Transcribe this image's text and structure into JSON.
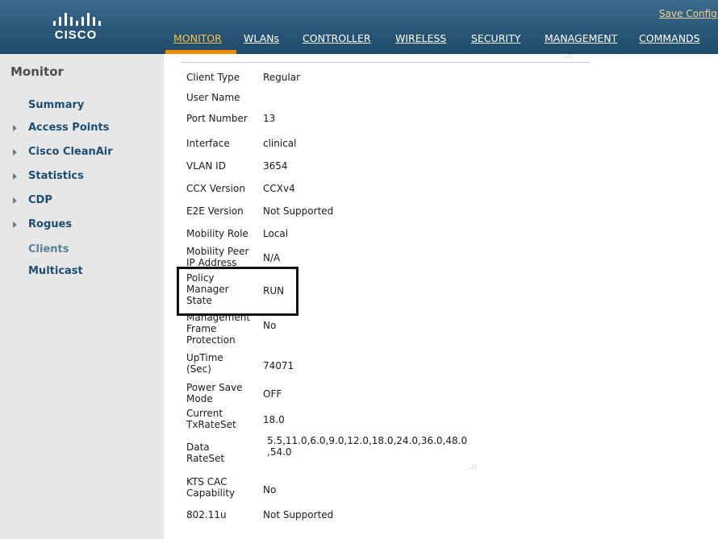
{
  "header": {
    "logo_text": "CISCO",
    "save_link": "Save Configuration",
    "nav": [
      {
        "label": "MONITOR",
        "active": true
      },
      {
        "label": "WLANs",
        "active": false
      },
      {
        "label": "CONTROLLER",
        "active": false
      },
      {
        "label": "WIRELESS",
        "active": false
      },
      {
        "label": "SECURITY",
        "active": false
      },
      {
        "label": "MANAGEMENT",
        "active": false
      },
      {
        "label": "COMMANDS",
        "active": false
      }
    ]
  },
  "sidebar": {
    "title": "Monitor",
    "items": [
      {
        "label": "Summary",
        "expandable": false
      },
      {
        "label": "Access Points",
        "expandable": true
      },
      {
        "label": "Cisco CleanAir",
        "expandable": true
      },
      {
        "label": "Statistics",
        "expandable": true
      },
      {
        "label": "CDP",
        "expandable": true
      },
      {
        "label": "Rogues",
        "expandable": true
      },
      {
        "label": "Clients",
        "expandable": false
      },
      {
        "label": "Multicast",
        "expandable": false
      }
    ]
  },
  "details": [
    {
      "label": "Client Type",
      "value": "Regular"
    },
    {
      "label": "User Name",
      "value": ""
    },
    {
      "label": "Port Number",
      "value": "13"
    },
    {
      "label": "Interface",
      "value": "clinical"
    },
    {
      "label": "VLAN ID",
      "value": "3654"
    },
    {
      "label": "CCX Version",
      "value": "CCXv4"
    },
    {
      "label": "E2E Version",
      "value": "Not Supported"
    },
    {
      "label": "Mobility Role",
      "value": "Local"
    },
    {
      "label": "Mobility Peer IP Address",
      "value": "N/A"
    },
    {
      "label": "Policy Manager State",
      "value": "RUN"
    },
    {
      "label": "Management Frame Protection",
      "value": "No"
    },
    {
      "label": "UpTime (Sec)",
      "value": "74071"
    },
    {
      "label": "Power Save Mode",
      "value": "OFF"
    },
    {
      "label": "Current TxRateSet",
      "value": "18.0"
    },
    {
      "label": "Data RateSet",
      "value": "5.5,11.0,6.0,9.0,12.0,18.0,24.0,36.0,48.0 ,54.0"
    },
    {
      "label": "KTS CAC Capability",
      "value": "No"
    },
    {
      "label": "802.11u",
      "value": "Not Supported"
    }
  ]
}
